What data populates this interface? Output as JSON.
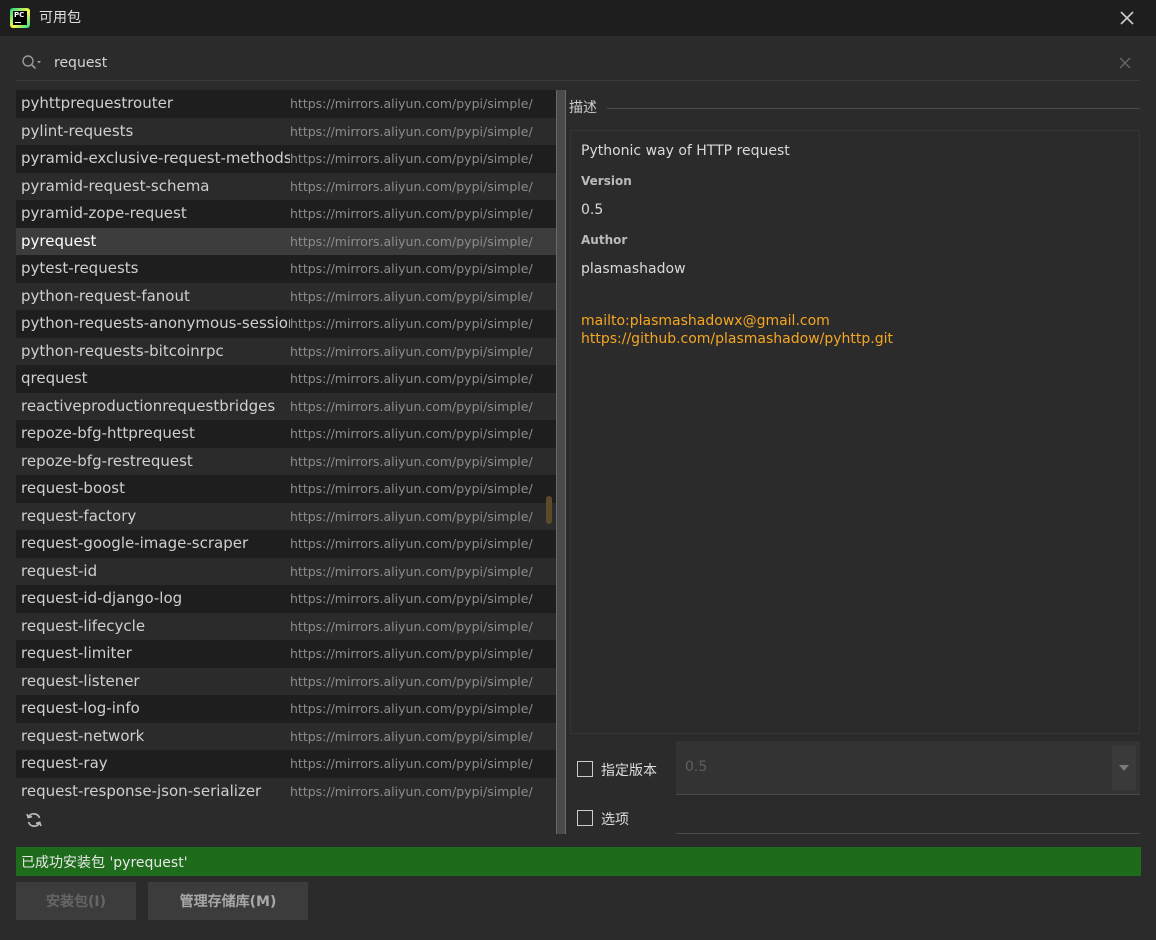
{
  "window": {
    "title": "可用包"
  },
  "search": {
    "value": "request",
    "placeholder": ""
  },
  "packages": [
    {
      "name": "pyhttprequestrouter",
      "repo": "https://mirrors.aliyun.com/pypi/simple/"
    },
    {
      "name": "pylint-requests",
      "repo": "https://mirrors.aliyun.com/pypi/simple/"
    },
    {
      "name": "pyramid-exclusive-request-methods",
      "repo": "https://mirrors.aliyun.com/pypi/simple/"
    },
    {
      "name": "pyramid-request-schema",
      "repo": "https://mirrors.aliyun.com/pypi/simple/"
    },
    {
      "name": "pyramid-zope-request",
      "repo": "https://mirrors.aliyun.com/pypi/simple/"
    },
    {
      "name": "pyrequest",
      "repo": "https://mirrors.aliyun.com/pypi/simple/",
      "selected": true
    },
    {
      "name": "pytest-requests",
      "repo": "https://mirrors.aliyun.com/pypi/simple/"
    },
    {
      "name": "python-request-fanout",
      "repo": "https://mirrors.aliyun.com/pypi/simple/"
    },
    {
      "name": "python-requests-anonymous-session",
      "repo": "https://mirrors.aliyun.com/pypi/simple/"
    },
    {
      "name": "python-requests-bitcoinrpc",
      "repo": "https://mirrors.aliyun.com/pypi/simple/"
    },
    {
      "name": "qrequest",
      "repo": "https://mirrors.aliyun.com/pypi/simple/"
    },
    {
      "name": "reactiveproductionrequestbridges",
      "repo": "https://mirrors.aliyun.com/pypi/simple/"
    },
    {
      "name": "repoze-bfg-httprequest",
      "repo": "https://mirrors.aliyun.com/pypi/simple/"
    },
    {
      "name": "repoze-bfg-restrequest",
      "repo": "https://mirrors.aliyun.com/pypi/simple/"
    },
    {
      "name": "request-boost",
      "repo": "https://mirrors.aliyun.com/pypi/simple/"
    },
    {
      "name": "request-factory",
      "repo": "https://mirrors.aliyun.com/pypi/simple/"
    },
    {
      "name": "request-google-image-scraper",
      "repo": "https://mirrors.aliyun.com/pypi/simple/"
    },
    {
      "name": "request-id",
      "repo": "https://mirrors.aliyun.com/pypi/simple/"
    },
    {
      "name": "request-id-django-log",
      "repo": "https://mirrors.aliyun.com/pypi/simple/"
    },
    {
      "name": "request-lifecycle",
      "repo": "https://mirrors.aliyun.com/pypi/simple/"
    },
    {
      "name": "request-limiter",
      "repo": "https://mirrors.aliyun.com/pypi/simple/"
    },
    {
      "name": "request-listener",
      "repo": "https://mirrors.aliyun.com/pypi/simple/"
    },
    {
      "name": "request-log-info",
      "repo": "https://mirrors.aliyun.com/pypi/simple/"
    },
    {
      "name": "request-network",
      "repo": "https://mirrors.aliyun.com/pypi/simple/"
    },
    {
      "name": "request-ray",
      "repo": "https://mirrors.aliyun.com/pypi/simple/"
    },
    {
      "name": "request-response-json-serializer",
      "repo": "https://mirrors.aliyun.com/pypi/simple/"
    }
  ],
  "description": {
    "legend": "描述",
    "summary": "Pythonic way of HTTP request",
    "version_label": "Version",
    "version": "0.5",
    "author_label": "Author",
    "author": "plasmashadow",
    "email_link": "mailto:plasmashadowx@gmail.com",
    "repo_link": "https://github.com/plasmashadow/pyhttp.git"
  },
  "options": {
    "specify_version_label": "指定版本",
    "version_value": "0.5",
    "options_label": "选项",
    "options_value": ""
  },
  "status": {
    "text": "已成功安装包 'pyrequest'"
  },
  "buttons": {
    "install": "安装包(I)",
    "manage": "管理存储库(M)"
  },
  "colors": {
    "status_green": "#1e6b1c",
    "link_orange": "#f5a623",
    "background": "#2b2b2b",
    "title_bar": "#1e1e1e"
  },
  "icons": [
    "pycharm-logo-icon",
    "close-icon",
    "search-icon",
    "clear-icon",
    "refresh-icon",
    "chevron-down-icon"
  ]
}
